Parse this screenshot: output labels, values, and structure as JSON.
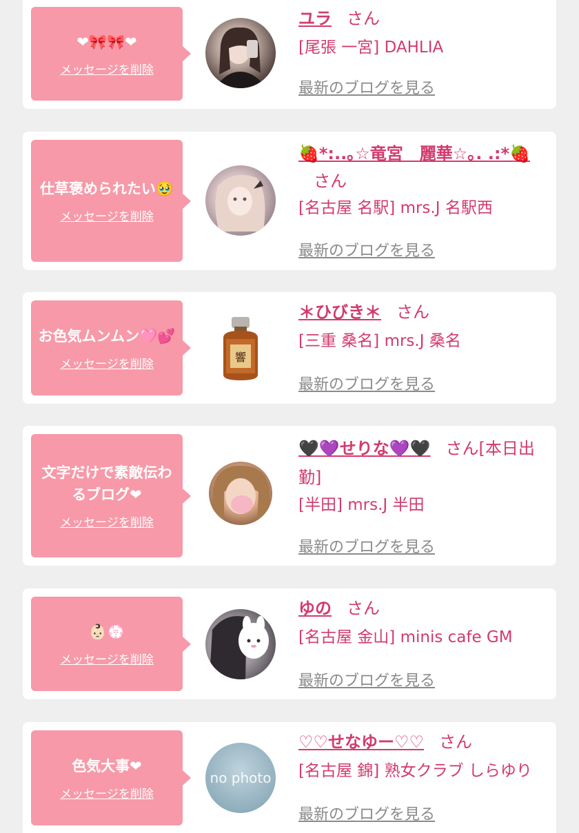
{
  "delete_label": "メッセージを削除",
  "blog_label": "最新のブログを見る",
  "san": "さん",
  "colors": {
    "accent": "#d23a6e",
    "bubble": "#f799a8",
    "background": "#efefef",
    "link_gray": "#8a8a8a"
  },
  "items": [
    {
      "bubble_text": "❤🎀🎀❤",
      "name": "ユラ",
      "suffix": "さん",
      "shop": "[尾張 一宮] DAHLIA"
    },
    {
      "bubble_text": "仕草褒められたい🥹",
      "name": "🍓*:..｡☆竜宮　麗華☆｡. .:*🍓",
      "suffix": "さん",
      "shop": "[名古屋 名駅] mrs.J 名駅西"
    },
    {
      "bubble_text": "お色気ムンムン🩷💕",
      "name": "＊ひびき＊",
      "suffix": "さん",
      "shop": "[三重 桑名] mrs.J 桑名"
    },
    {
      "bubble_text": "文字だけで素敵伝わるブログ❤",
      "name": "🖤💜せりな💜🖤",
      "suffix": "さん[本日出勤]",
      "shop": "[半田] mrs.J 半田"
    },
    {
      "bubble_text": "👶🏻💮",
      "name": "ゆの",
      "suffix": "さん",
      "shop": "[名古屋 金山] minis cafe GM"
    },
    {
      "bubble_text": "色気大事❤",
      "name": "♡♡せなゆー♡♡",
      "suffix": "さん",
      "shop": "[名古屋 錦] 熟女クラブ しらゆり",
      "avatar_text": "no photo"
    }
  ]
}
